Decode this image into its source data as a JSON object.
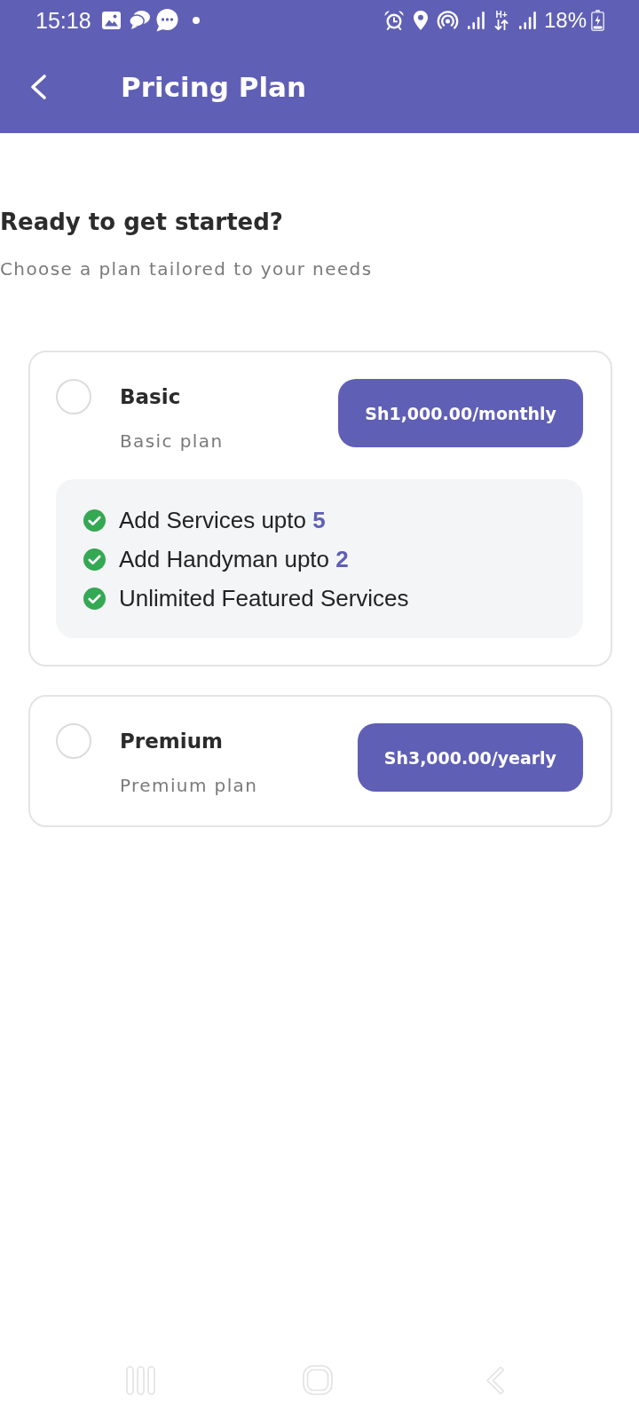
{
  "status_bar": {
    "time": "15:18",
    "network_type": "H+",
    "battery": "18%"
  },
  "header": {
    "title": "Pricing Plan"
  },
  "intro": {
    "title": "Ready to get started?",
    "subtitle": "Choose a plan tailored to your needs"
  },
  "plans": [
    {
      "name": "Basic",
      "description": "Basic plan",
      "price": "Sh1,000.00/monthly",
      "selected": false,
      "features": [
        "Add Services upto **5**",
        "Add Handyman upto **2**",
        "Unlimited Featured Services"
      ]
    },
    {
      "name": "Premium",
      "description": "Premium plan",
      "price": "Sh3,000.00/yearly",
      "selected": false
    }
  ]
}
